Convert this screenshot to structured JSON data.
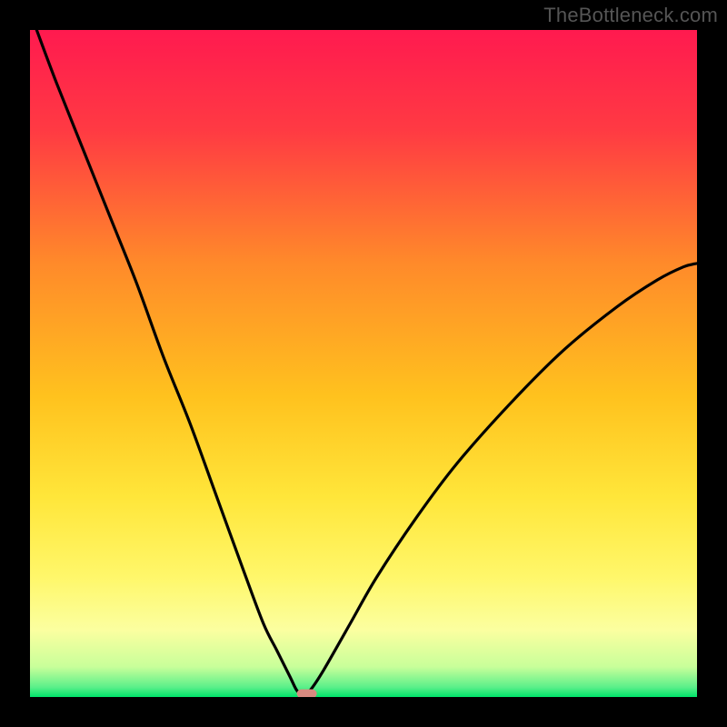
{
  "watermark": "TheBottleneck.com",
  "chart_data": {
    "type": "line",
    "title": "",
    "xlabel": "",
    "ylabel": "",
    "xlim": [
      0,
      100
    ],
    "ylim": [
      0,
      100
    ],
    "background": {
      "description": "Vertical gradient from red at top through orange and yellow to green at bottom, representing bottleneck severity (red=high, green=none)",
      "stops": [
        {
          "pos": 0.0,
          "color": "#ff1a4f"
        },
        {
          "pos": 0.15,
          "color": "#ff3a43"
        },
        {
          "pos": 0.35,
          "color": "#ff8a2a"
        },
        {
          "pos": 0.55,
          "color": "#ffc21e"
        },
        {
          "pos": 0.7,
          "color": "#ffe63a"
        },
        {
          "pos": 0.82,
          "color": "#fff76a"
        },
        {
          "pos": 0.9,
          "color": "#fbffa0"
        },
        {
          "pos": 0.955,
          "color": "#c8ff9a"
        },
        {
          "pos": 0.985,
          "color": "#5cf08a"
        },
        {
          "pos": 1.0,
          "color": "#00e46a"
        }
      ]
    },
    "series": [
      {
        "name": "bottleneck-curve",
        "description": "V-shaped black curve; descends from top-left, reaches a minimum near x≈41 at y≈0, then rises concavely toward upper right with slight flattening near the top.",
        "x": [
          1.0,
          4.0,
          8.0,
          12.0,
          16.0,
          20.0,
          24.0,
          28.0,
          32.0,
          35.0,
          37.0,
          39.0,
          40.0,
          41.0,
          42.0,
          44.0,
          48.0,
          52.0,
          58.0,
          64.0,
          72.0,
          80.0,
          88.0,
          94.0,
          98.0,
          100.0
        ],
        "y": [
          100.0,
          92.0,
          82.0,
          72.0,
          62.0,
          51.0,
          41.0,
          30.0,
          19.0,
          11.0,
          7.0,
          3.0,
          1.0,
          0.3,
          1.0,
          4.0,
          11.0,
          18.0,
          27.0,
          35.0,
          44.0,
          52.0,
          58.5,
          62.5,
          64.5,
          65.0
        ]
      }
    ],
    "marker": {
      "description": "Small salmon pill at the minimum of the curve",
      "x": 41.5,
      "y": 0.5,
      "width_pct": 3.0,
      "height_pct": 1.3,
      "color": "#d88a80"
    }
  }
}
